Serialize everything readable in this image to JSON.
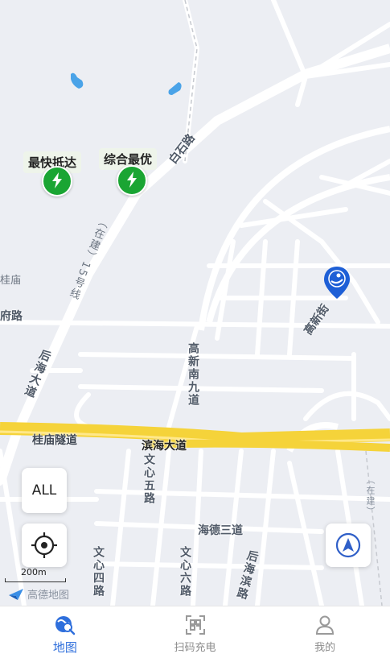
{
  "map": {
    "roads": {
      "baishi": "白石路",
      "houhai": "后海大道",
      "guimiao_tunnel": "桂庙隧道",
      "binhai": "滨海大道",
      "gaoxin_nan_jiu": "高新南九道",
      "gaoxin_street": "高新街",
      "wenxin_wu": "文心五路",
      "wenxin_si": "文心四路",
      "wenxin_liu": "文心六路",
      "haide_san": "海德三道",
      "houhai_bin": "后海滨路",
      "line15": "（在建）15号线",
      "under_construction": "（在建）",
      "guimiao": "桂庙",
      "fu_road": "府路"
    },
    "pins": {
      "fastest": "最快抵达",
      "best": "综合最优"
    },
    "scale": "200m",
    "brand": "高德地图",
    "all_button": "ALL"
  },
  "tabs": [
    {
      "label": "地图",
      "icon": "map-search-icon",
      "active": true
    },
    {
      "label": "扫码充电",
      "icon": "scan-icon",
      "active": false
    },
    {
      "label": "我的",
      "icon": "user-icon",
      "active": false
    }
  ],
  "colors": {
    "accent": "#2f6fdc",
    "charger": "#1aa533",
    "expressway": "#f5d33a"
  }
}
